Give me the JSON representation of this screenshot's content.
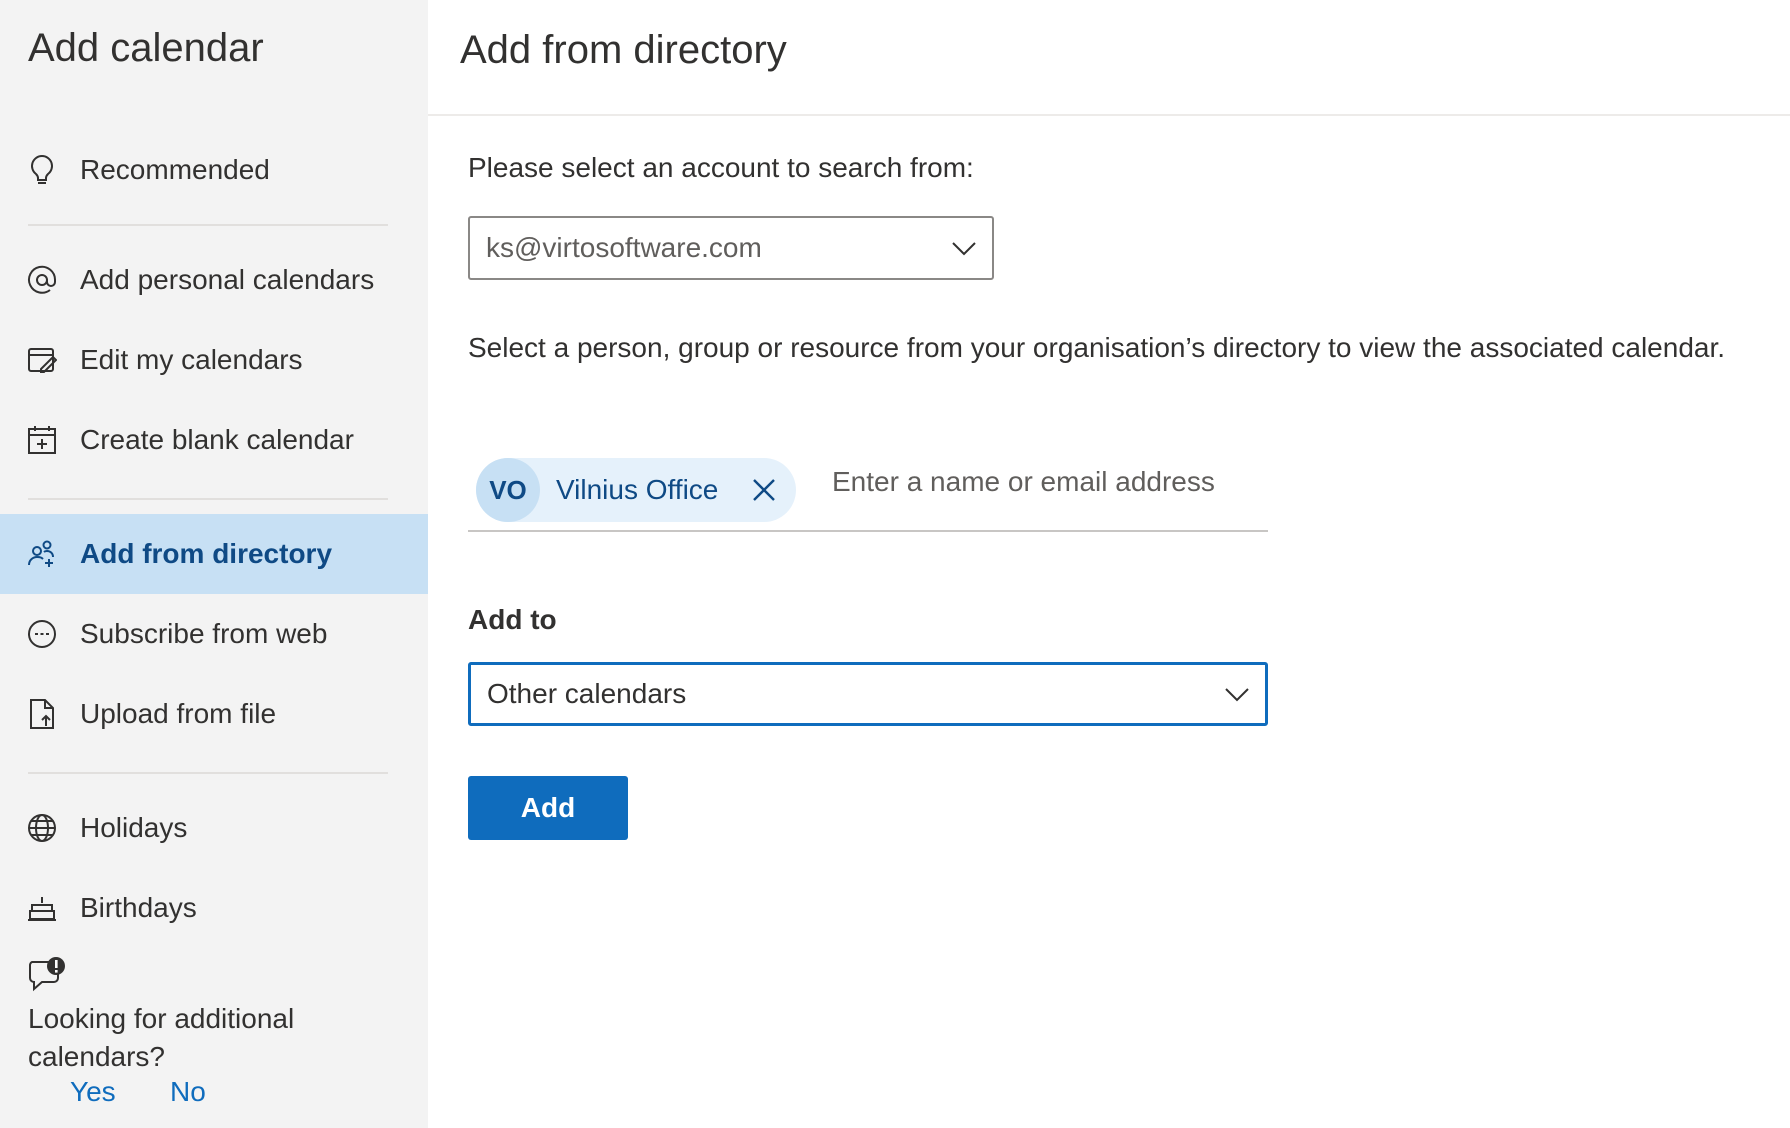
{
  "sidebar": {
    "title": "Add calendar",
    "items": [
      {
        "label": "Recommended",
        "icon": "lightbulb-icon"
      },
      {
        "label": "Add personal calendars",
        "icon": "at-sign-icon"
      },
      {
        "label": "Edit my calendars",
        "icon": "edit-calendar-icon"
      },
      {
        "label": "Create blank calendar",
        "icon": "calendar-add-icon"
      },
      {
        "label": "Add from directory",
        "icon": "people-add-icon",
        "selected": true
      },
      {
        "label": "Subscribe from web",
        "icon": "link-circle-icon"
      },
      {
        "label": "Upload from file",
        "icon": "file-upload-icon"
      },
      {
        "label": "Holidays",
        "icon": "globe-icon"
      },
      {
        "label": "Birthdays",
        "icon": "cake-icon"
      }
    ],
    "feedback": {
      "icon": "chat-warning-icon",
      "question": "Looking for additional calendars?",
      "yes": "Yes",
      "no": "No"
    }
  },
  "main": {
    "title": "Add from directory",
    "account_prompt": "Please select an account to search from:",
    "account_select": {
      "value": "ks@virtosoftware.com",
      "icon": "chevron-down-icon"
    },
    "instructions": "Select a person, group or resource from your organisation’s directory to view the associated calendar.",
    "people_picker": {
      "selected": [
        {
          "initials": "VO",
          "name": "Vilnius Office"
        }
      ],
      "placeholder": "Enter a name or email address"
    },
    "add_to": {
      "label": "Add to",
      "value": "Other calendars"
    },
    "add_button": "Add"
  },
  "colors": {
    "sidebar_bg": "#f3f3f3",
    "selected_bg": "#c7e0f4",
    "accent": "#0f6cbd",
    "selected_text": "#0f4a85",
    "chip_bg": "#e5f1fb"
  }
}
